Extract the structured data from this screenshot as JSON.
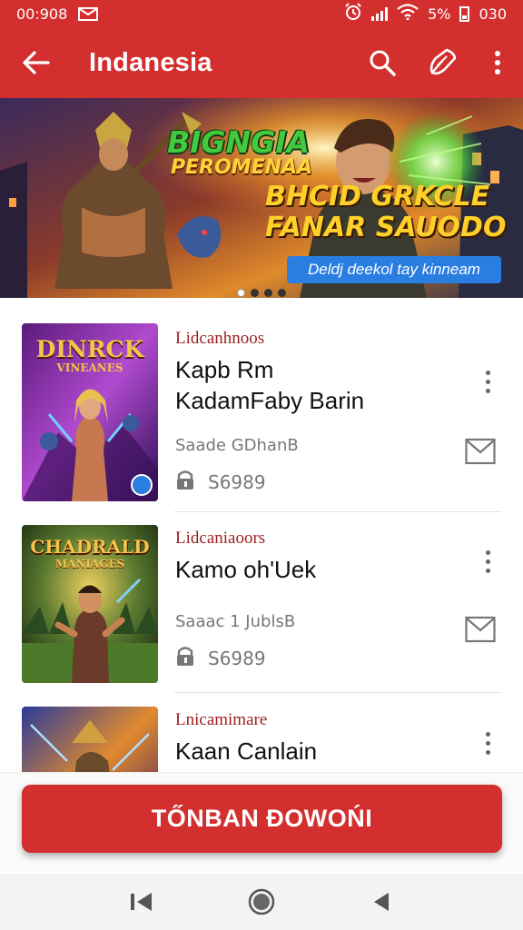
{
  "status_bar": {
    "time": "00:908",
    "battery_percent": "5%",
    "right_text": "030",
    "icons": [
      "mail-icon",
      "alarm-icon",
      "signal-icon",
      "wifi-icon",
      "battery-icon"
    ]
  },
  "app_bar": {
    "title": "Indanesia",
    "icons": [
      "back-arrow-icon",
      "search-icon",
      "edit-pen-icon",
      "overflow-menu-icon"
    ]
  },
  "banner": {
    "title_line1": "BIGNGIA",
    "title_line2": "PEROMENAA",
    "headline_line1": "BHCID GRKCLE",
    "headline_line2": "FANAR SAUODO",
    "cta_label": "Deldj deekol tay kinneam",
    "pages": 4,
    "active_page": 1
  },
  "items": [
    {
      "thumb_title": "DINRCK",
      "thumb_subtitle": "VINEANES",
      "category": "Lidcanhnoos",
      "name_line1": "Kapb Rm",
      "name_line2": "KadamFaby Barin",
      "meta": "Saade GDhanB",
      "price": "S6989"
    },
    {
      "thumb_title": "CHADRALD",
      "thumb_subtitle": "MANIAGES",
      "category": "Lidcaniaoors",
      "name_line1": "Kamo oh'Uek",
      "name_line2": "",
      "meta": "Saaac 1 JublsB",
      "price": "S6989"
    },
    {
      "thumb_title": "",
      "thumb_subtitle": "",
      "category": "Lnicamimare",
      "name_line1": "Kaan Canlain",
      "name_line2": "",
      "meta": "",
      "price": ""
    }
  ],
  "bottom_button": {
    "label": "TŐNBAN ĐOWOŃI"
  },
  "nav_bar": {
    "icons": [
      "recents-icon",
      "home-icon",
      "back-icon"
    ]
  },
  "colors": {
    "primary_red": "#d32f2f",
    "category_red": "#9c1e1e",
    "cta_blue": "#2a7de1"
  }
}
